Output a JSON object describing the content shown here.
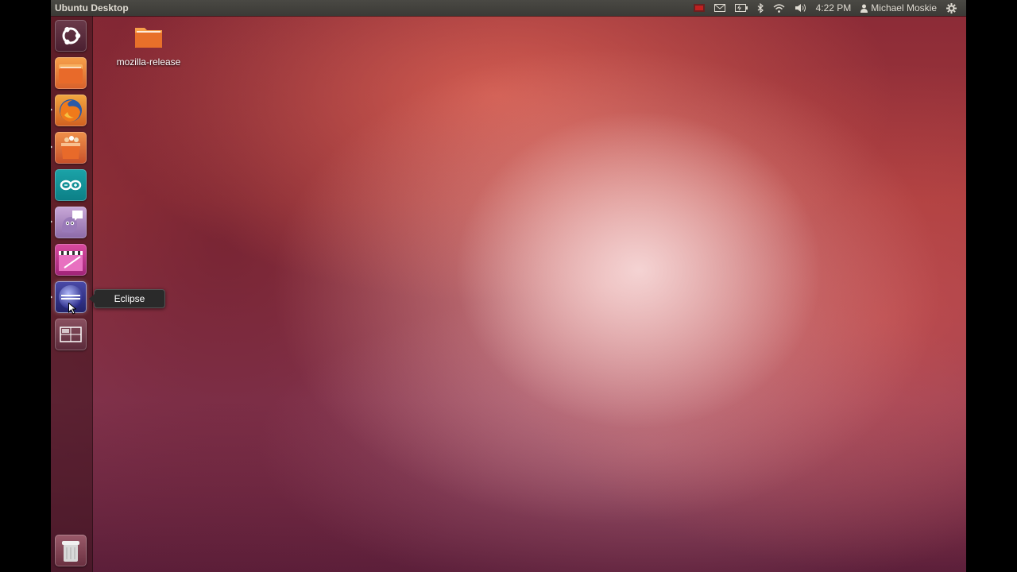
{
  "panel": {
    "title": "Ubuntu Desktop",
    "clock": "4:22 PM",
    "user": "Michael Moskie",
    "indicators": [
      "keyboard-layout-icon",
      "mail-icon",
      "battery-icon",
      "bluetooth-icon",
      "wifi-icon",
      "volume-icon",
      "user-icon",
      "power-gear-icon"
    ]
  },
  "launcher": {
    "items": [
      {
        "name": "dash-home",
        "icon": "ubuntu-logo-icon"
      },
      {
        "name": "home-folder",
        "icon": "folder-icon"
      },
      {
        "name": "firefox",
        "icon": "firefox-icon",
        "running": true
      },
      {
        "name": "software-center",
        "icon": "shopping-bag-icon",
        "running": true
      },
      {
        "name": "arduino",
        "icon": "arduino-icon"
      },
      {
        "name": "pidgin",
        "icon": "pidgin-icon",
        "running": true
      },
      {
        "name": "video-editor",
        "icon": "clapper-icon"
      },
      {
        "name": "eclipse",
        "icon": "eclipse-icon",
        "running": true
      },
      {
        "name": "workspace-switcher",
        "icon": "workspace-icon"
      },
      {
        "name": "trash",
        "icon": "trash-icon"
      }
    ],
    "tooltip": "Eclipse"
  },
  "desktop": {
    "icons": [
      {
        "label": "mozilla-release",
        "icon": "folder-icon"
      }
    ]
  },
  "colors": {
    "panel_bg": "#3c3b37",
    "launcher_bg": "#3c141e",
    "accent": "#dd4814"
  }
}
